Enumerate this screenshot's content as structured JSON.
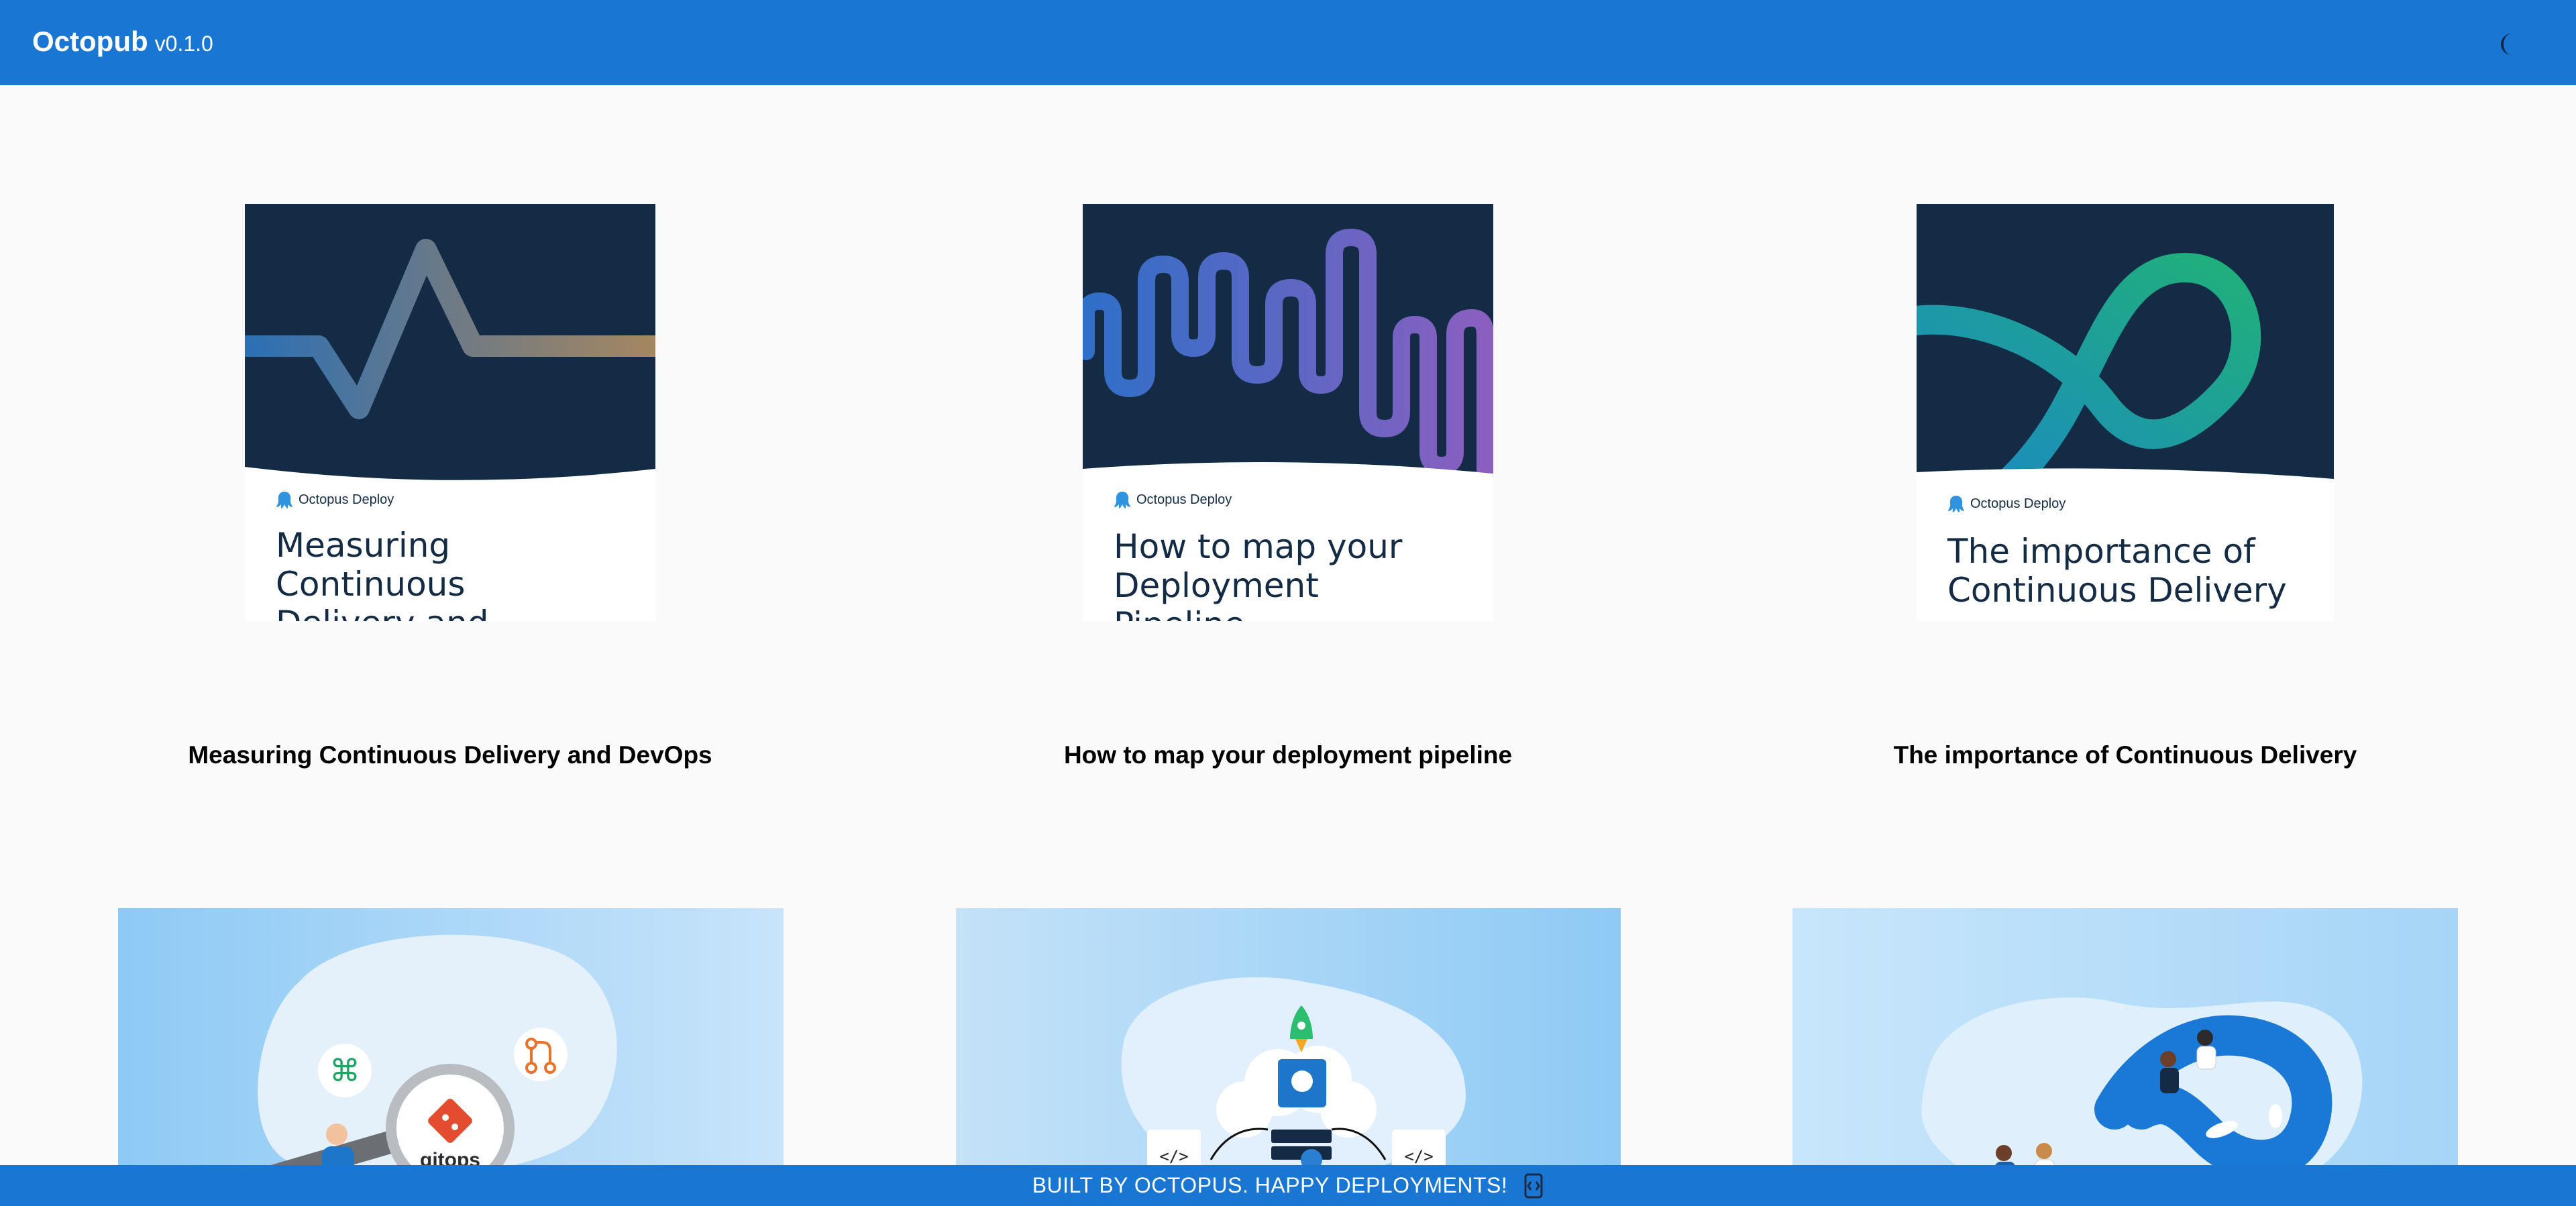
{
  "app": {
    "name": "Octopub",
    "version": "v0.1.0",
    "theme_icon": "moon-icon"
  },
  "cards": [
    {
      "cover_brand": "Octopus Deploy",
      "cover_title": "Measuring Continuous Delivery and DevOps",
      "title": "Measuring Continuous Delivery and DevOps"
    },
    {
      "cover_brand": "Octopus Deploy",
      "cover_title": "How to map your Deployment Pipeline",
      "title": "How to map your deployment pipeline"
    },
    {
      "cover_brand": "Octopus Deploy",
      "cover_title": "The importance of Continuous Delivery",
      "title": "The importance of Continuous Delivery"
    }
  ],
  "heroes": [
    {
      "label": "gitops",
      "icons": [
        "command-icon",
        "git-pull-request-icon",
        "function-icon",
        "git-logo-icon",
        "magnifier-icon"
      ]
    },
    {
      "label": "</>",
      "icons": [
        "rocket-icon",
        "octopus-icon",
        "server-icon",
        "gear-icon",
        "code-icon"
      ]
    },
    {
      "label": "",
      "icons": [
        "infinity-loop-icon",
        "people-with-laptops-icon"
      ]
    }
  ],
  "footer": {
    "text": "BUILT BY OCTOPUS. HAPPY DEPLOYMENTS!",
    "icon": "code-bracket-icon"
  },
  "colors": {
    "appbar": "#1976d2",
    "cover_dark": "#132b44",
    "background": "#fafafa"
  }
}
